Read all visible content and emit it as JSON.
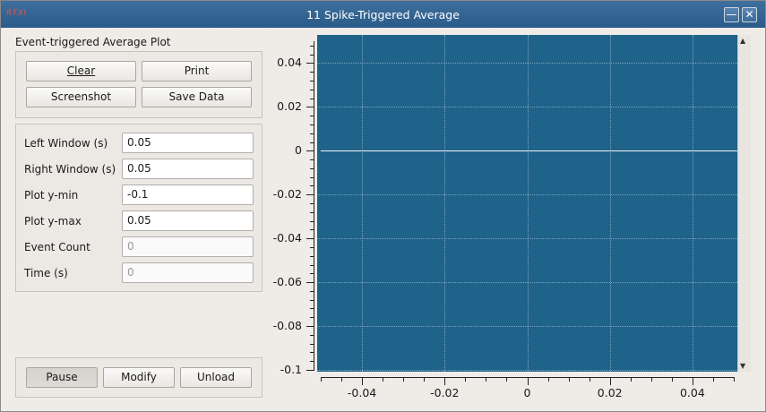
{
  "window": {
    "app_logo": "RTXI",
    "title": "11 Spike-Triggered Average",
    "minimize_glyph": "—",
    "close_glyph": "✕"
  },
  "panel": {
    "title": "Event-triggered Average Plot",
    "buttons": {
      "clear": "Clear",
      "print": "Print",
      "screenshot": "Screenshot",
      "save_data": "Save Data"
    },
    "parameters": [
      {
        "label": "Left Window (s)",
        "value": "0.05",
        "enabled": true
      },
      {
        "label": "Right Window (s)",
        "value": "0.05",
        "enabled": true
      },
      {
        "label": "Plot y-min",
        "value": "-0.1",
        "enabled": true
      },
      {
        "label": "Plot y-max",
        "value": "0.05",
        "enabled": true
      },
      {
        "label": "Event Count",
        "value": "0",
        "enabled": false
      },
      {
        "label": "Time (s)",
        "value": "0",
        "enabled": false
      }
    ],
    "controls": {
      "pause": "Pause",
      "modify": "Modify",
      "unload": "Unload"
    }
  },
  "chart_data": {
    "type": "line",
    "title": "",
    "xlabel": "",
    "ylabel": "",
    "xlim": [
      -0.05,
      0.05
    ],
    "ylim": [
      -0.1,
      0.05
    ],
    "x_ticks": [
      "-0.04",
      "-0.02",
      "0",
      "0.02",
      "0.04"
    ],
    "y_ticks": [
      "0.04",
      "0.02",
      "0",
      "-0.02",
      "-0.04",
      "-0.06",
      "-0.08",
      "-0.1"
    ],
    "series": [
      {
        "x": [
          -0.05,
          0.05
        ],
        "y": [
          0,
          0
        ]
      }
    ],
    "grid": true,
    "background_color": "#1f628a",
    "trace_color": "#f4f4f4"
  }
}
